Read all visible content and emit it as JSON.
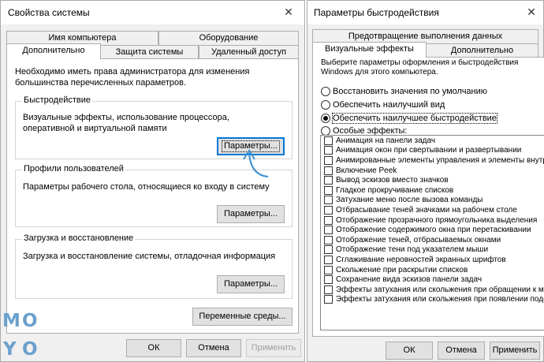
{
  "left_window": {
    "title": "Свойства системы",
    "tabs_back": [
      "Имя компьютера",
      "Оборудование"
    ],
    "tabs_front": [
      "Дополнительно",
      "Защита системы",
      "Удаленный доступ"
    ],
    "admin_note": "Необходимо иметь права администратора для изменения большинства перечисленных параметров.",
    "groups": [
      {
        "title": "Быстродействие",
        "text": "Визуальные эффекты, использование процессора, оперативной и виртуальной памяти",
        "button": "Параметры..."
      },
      {
        "title": "Профили пользователей",
        "text": "Параметры рабочего стола, относящиеся ко входу в систему",
        "button": "Параметры..."
      },
      {
        "title": "Загрузка и восстановление",
        "text": "Загрузка и восстановление системы, отладочная информация",
        "button": "Параметры..."
      }
    ],
    "env_button": "Переменные среды...",
    "ok": "ОК",
    "cancel": "Отмена",
    "apply": "Применить"
  },
  "right_window": {
    "title": "Параметры быстродействия",
    "tab_back": "Предотвращение выполнения данных",
    "tabs_front": [
      "Визуальные эффекты",
      "Дополнительно"
    ],
    "description": "Выберите параметры оформления и быстродействия Windows для этого компьютера.",
    "radios": [
      {
        "label": "Восстановить значения по умолчанию",
        "checked": false
      },
      {
        "label": "Обеспечить наилучший вид",
        "checked": false
      },
      {
        "label": "Обеспечить наилучшее быстродействие",
        "checked": true
      },
      {
        "label": "Особые эффекты:",
        "checked": false
      }
    ],
    "effects": [
      "Анимация на панели задач",
      "Анимация окон при свертывании и развертывании",
      "Анимированные элементы управления и элементы внутри",
      "Включение Peek",
      "Вывод эскизов вместо значков",
      "Гладкое прокручивание списков",
      "Затухание меню после вызова команды",
      "Отбрасывание теней значками на рабочем столе",
      "Отображение прозрачного прямоугольника выделения",
      "Отображение содержимого окна при перетаскивании",
      "Отображение теней, отбрасываемых окнами",
      "Отображение тени под указателем мыши",
      "Сглаживание неровностей экранных шрифтов",
      "Скольжение при раскрытии списков",
      "Сохранение вида эскизов панели задач",
      "Эффекты затухания или скольжения при обращении к ме",
      "Эффекты затухания или скольжения при появлении подс"
    ],
    "ok": "ОК",
    "cancel": "Отмена",
    "apply": "Применить"
  },
  "watermark": [
    "M",
    "O",
    "Y",
    "O"
  ],
  "colors": {
    "focus_blue": "#0078d7",
    "arrow_blue": "#3d8fd1",
    "logo_blue": "#6aa0cc"
  },
  "icons": {
    "close": "close-icon",
    "arrow": "curved-arrow-icon"
  }
}
